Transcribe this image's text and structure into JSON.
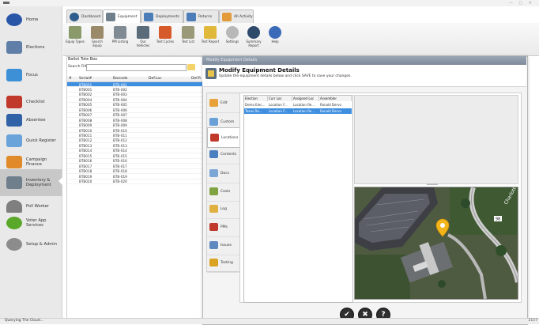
{
  "window": {
    "controls": "—  ▢  ✕"
  },
  "sidebar": {
    "items": [
      {
        "label": "Home",
        "color": "#2a56a8"
      },
      {
        "label": "Elections",
        "color": "#5f7fa8"
      },
      {
        "label": "Focus",
        "color": "#3d8fd6"
      },
      {
        "label": "Checklist",
        "color": "#c0392b"
      },
      {
        "label": "Absentee",
        "color": "#3161a6"
      },
      {
        "label": "Quick Register",
        "color": "#6aa3d9"
      },
      {
        "label": "Campaign Finance",
        "color": "#e08a2a"
      },
      {
        "label": "Inventory & Deployment",
        "color": "#6f7f8c"
      },
      {
        "label": "Poll Worker",
        "color": "#7f7f7f"
      },
      {
        "label": "Voter App Services",
        "color": "#5aa82a"
      },
      {
        "label": "Setup & Admin",
        "color": "#8c8c8c"
      }
    ]
  },
  "tabs": [
    {
      "label": "Dashboard"
    },
    {
      "label": "Equipment"
    },
    {
      "label": "Deployments"
    },
    {
      "label": "Returns"
    },
    {
      "label": "All Activity"
    }
  ],
  "ribbon": {
    "buttons": [
      {
        "label": "Equip Types"
      },
      {
        "label": "Search Equip"
      },
      {
        "label": "PM Listing"
      },
      {
        "label": "Our Vehicles"
      },
      {
        "label": "Test Cycles"
      },
      {
        "label": "Test List"
      },
      {
        "label": "Test Report"
      },
      {
        "label": "Settings"
      },
      {
        "label": "Summary Report"
      },
      {
        "label": "Help"
      }
    ]
  },
  "list": {
    "title": "Ballot Tote Box",
    "search_label": "Search Filter:",
    "search_value": "",
    "columns": [
      "Serial#",
      "Barcode",
      "Def.Loc",
      "Def.R"
    ],
    "rows": [
      {
        "serial": "BTB001",
        "barcode": "BTB-001",
        "selected": true
      },
      {
        "serial": "BTB001",
        "barcode": "BTB-002"
      },
      {
        "serial": "BTB002",
        "barcode": "BTB-003"
      },
      {
        "serial": "BTB004",
        "barcode": "BTB-004"
      },
      {
        "serial": "BTB005",
        "barcode": "BTB-005"
      },
      {
        "serial": "BTB006",
        "barcode": "BTB-006"
      },
      {
        "serial": "BTB007",
        "barcode": "BTB-007"
      },
      {
        "serial": "BTB008",
        "barcode": "BTB-008"
      },
      {
        "serial": "BTB009",
        "barcode": "BTB-009"
      },
      {
        "serial": "BTB010",
        "barcode": "BTB-010"
      },
      {
        "serial": "BTB011",
        "barcode": "BTB-011"
      },
      {
        "serial": "BTB012",
        "barcode": "BTB-012"
      },
      {
        "serial": "BTB013",
        "barcode": "BTB-013"
      },
      {
        "serial": "BTB014",
        "barcode": "BTB-014"
      },
      {
        "serial": "BTB015",
        "barcode": "BTB-015"
      },
      {
        "serial": "BTB016",
        "barcode": "BTB-016"
      },
      {
        "serial": "BTB017",
        "barcode": "BTB-017"
      },
      {
        "serial": "BTB018",
        "barcode": "BTB-018"
      },
      {
        "serial": "BTB019",
        "barcode": "BTB-019"
      },
      {
        "serial": "BTB020",
        "barcode": "BTB-020"
      }
    ]
  },
  "dialog": {
    "window_title": "Modify Equipment Details",
    "heading": "Modify Equipment Details",
    "subtitle": "Update the equipment details below and click SAVE to save your changes.",
    "nav": [
      {
        "label": "Edit",
        "color": "#e8a23a"
      },
      {
        "label": "Custom",
        "color": "#6aa0d8"
      },
      {
        "label": "Locations",
        "color": "#c0392b",
        "active": true
      },
      {
        "label": "Contents",
        "color": "#4a7fc0"
      },
      {
        "label": "Docs",
        "color": "#7aa7d6"
      },
      {
        "label": "Costs",
        "color": "#7fa340"
      },
      {
        "label": "Log",
        "color": "#e0b040"
      },
      {
        "label": "PMs",
        "color": "#c0392b"
      },
      {
        "label": "Issues",
        "color": "#5e88c0"
      },
      {
        "label": "Testing",
        "color": "#d9a321"
      }
    ],
    "locations": {
      "columns": [
        "Election",
        "Curr Loc",
        "Assigned Loc",
        "Assembler"
      ],
      "rows": [
        {
          "election": "Demo Elec...",
          "curr": "Location F...",
          "assigned": "Location Re...",
          "assembler": "Ronald Dervo",
          "selected": false
        },
        {
          "election": "Texas De...",
          "curr": "Location F...",
          "assigned": "Location Re...",
          "assembler": "Ronald Dervo",
          "selected": true
        }
      ]
    },
    "map": {
      "road_label": "Charlotte",
      "route_shield": "98"
    },
    "buttons": [
      {
        "symbol": "✔"
      },
      {
        "symbol": "✖"
      },
      {
        "symbol": "?"
      }
    ]
  },
  "status": {
    "text": "Querying The Cloud...",
    "right": "2157"
  }
}
